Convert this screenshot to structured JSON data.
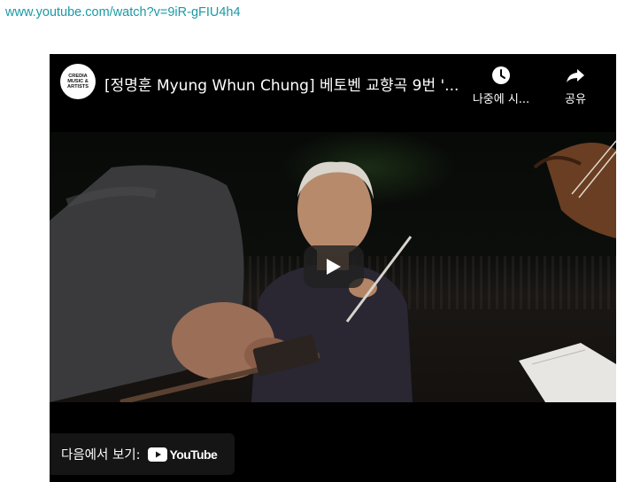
{
  "page": {
    "url_text": "www.youtube.com/watch?v=9iR-gFIU4h4"
  },
  "player": {
    "title": "[정명훈 Myung Whun Chung] 베토벤 교향곡 9번 '...",
    "channel_logo_text": "CREDIA\nMUSIC &\nARTISTS",
    "watch_later_label": "나중에 시...",
    "share_label": "공유",
    "watch_on_label": "다음에서 보기:",
    "youtube_wordmark": "YouTube",
    "icons": {
      "watch_later": "clock-icon",
      "share": "share-arrow-icon",
      "play": "play-icon",
      "youtube": "youtube-logo-icon"
    },
    "colors": {
      "link": "#1a9aa6",
      "player_bg": "#000000",
      "youtube_red": "#ffffff"
    }
  }
}
